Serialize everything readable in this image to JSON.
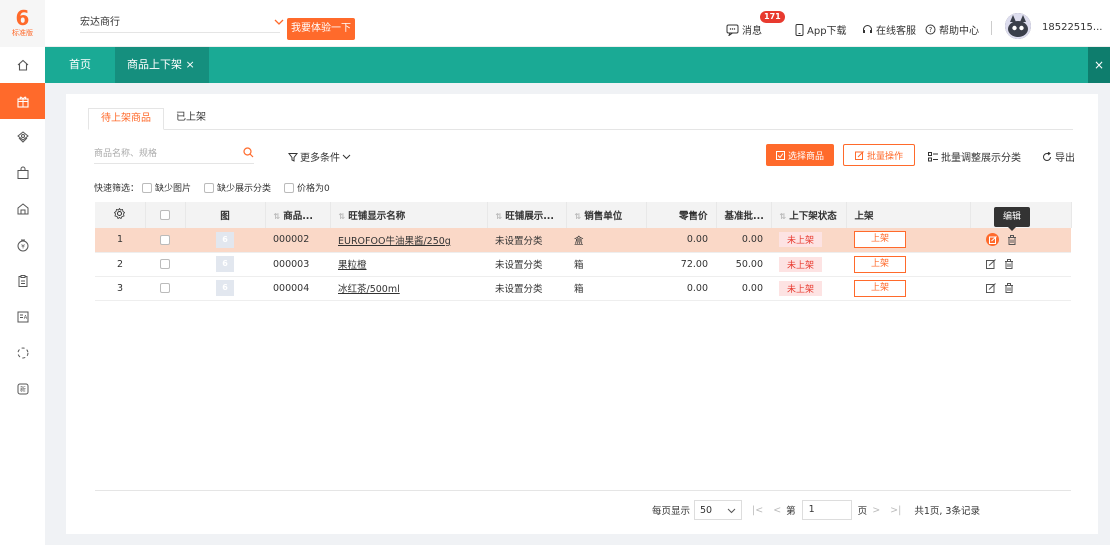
{
  "logo": {
    "mark": "6",
    "version": "标准版"
  },
  "header": {
    "shop_name": "宏达商行",
    "trial_button": "我要体验一下",
    "message_label": "消息",
    "message_count": "171",
    "app_download": "App下载",
    "online_service": "在线客服",
    "help_center": "帮助中心",
    "phone": "18522515..."
  },
  "tabs": {
    "home": "首页",
    "current": "商品上下架 ×"
  },
  "subtabs": [
    {
      "label": "待上架商品",
      "active": true
    },
    {
      "label": "已上架",
      "active": false
    }
  ],
  "toolbar": {
    "search_placeholder": "商品名称、规格",
    "more_conditions": "更多条件",
    "select_goods": "选择商品",
    "batch_operation": "批量操作",
    "batch_adjust": "批量调整展示分类",
    "export": "导出"
  },
  "quick_filter": {
    "label": "快速筛选：",
    "options": [
      "缺少图片",
      "缺少展示分类",
      "价格为0"
    ]
  },
  "table": {
    "columns": [
      "",
      "",
      "图",
      "商品...",
      "旺铺显示名称",
      "旺铺展示...",
      "销售单位",
      "零售价",
      "基准批...",
      "上下架状态",
      "上架",
      ""
    ],
    "rows": [
      {
        "index": "1",
        "code": "000002",
        "name": "EUROFOO牛油果酱/250g",
        "category": "未设置分类",
        "unit": "盒",
        "retail": "0.00",
        "wholesale": "0.00",
        "status": "未上架",
        "action": "上架",
        "highlighted": true
      },
      {
        "index": "2",
        "code": "000003",
        "name": "果粒橙",
        "category": "未设置分类",
        "unit": "箱",
        "retail": "72.00",
        "wholesale": "50.00",
        "status": "未上架",
        "action": "上架",
        "highlighted": false
      },
      {
        "index": "3",
        "code": "000004",
        "name": "冰红茶/500ml",
        "category": "未设置分类",
        "unit": "箱",
        "retail": "0.00",
        "wholesale": "0.00",
        "status": "未上架",
        "action": "上架",
        "highlighted": false
      }
    ]
  },
  "tooltip": "编辑",
  "pagination": {
    "per_page_label": "每页显示",
    "per_page": "50",
    "page_prefix": "第",
    "current_page": "1",
    "page_suffix": "页",
    "summary": "共1页, 3条记录"
  }
}
